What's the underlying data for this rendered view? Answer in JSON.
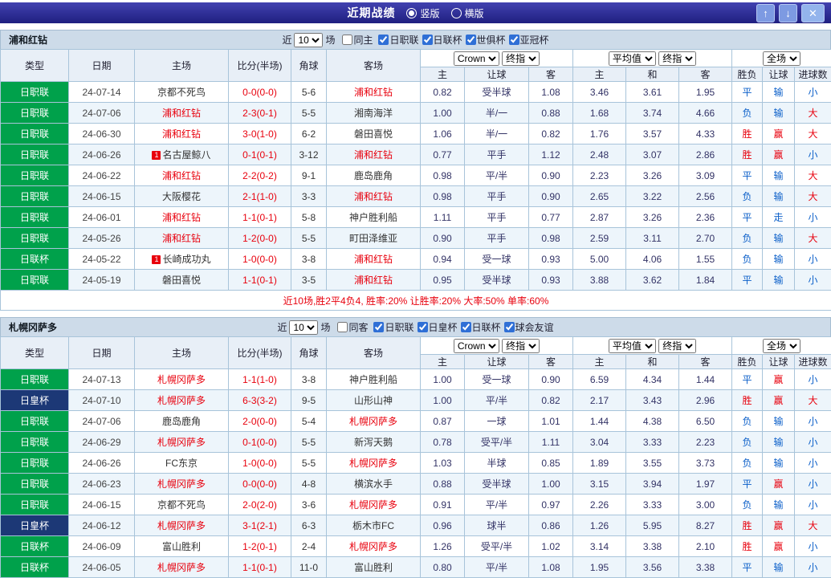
{
  "topbar": {
    "title": "近期战绩",
    "radios": [
      {
        "label": "竖版",
        "selected": true
      },
      {
        "label": "横版",
        "selected": false
      }
    ],
    "buttons": {
      "up": "↑",
      "down": "↓",
      "close": "✕"
    }
  },
  "filter_labels": {
    "near": "近",
    "games": "场"
  },
  "selects": {
    "company": "Crown",
    "final": "终指",
    "average": "平均值",
    "full": "全场"
  },
  "table_headers": {
    "left": [
      "类型",
      "日期",
      "主场",
      "比分(半场)",
      "角球",
      "客场"
    ],
    "odds_sub": [
      "主",
      "让球",
      "客"
    ],
    "avg_sub": [
      "主",
      "和",
      "客"
    ],
    "result_sub": [
      "胜负",
      "让球",
      "进球数"
    ]
  },
  "league_colors": {
    "日职联": "#00a14b",
    "日联杯": "#00a14b",
    "日皇杯": "#1c3876",
    "default": "#00a14b"
  },
  "red_results": [
    "胜",
    "赢",
    "大"
  ],
  "colors": {
    "result_red": "#e8000d",
    "result_blue": "#0b5fc9",
    "team_red": "#e8000d",
    "header_bar": "#2a2a96"
  },
  "sections": [
    {
      "team": "浦和红钻",
      "filter": {
        "count": "10",
        "toggle": {
          "label": "同主",
          "checked": false
        },
        "leagues": [
          {
            "label": "日职联",
            "checked": true
          },
          {
            "label": "日联杯",
            "checked": true
          },
          {
            "label": "世俱杯",
            "checked": true
          },
          {
            "label": "亚冠杯",
            "checked": true
          }
        ]
      },
      "rows": [
        {
          "league": "日职联",
          "date": "24-07-14",
          "home": "京都不死鸟",
          "home_team": false,
          "badge": "",
          "score": "0-0(0-0)",
          "corners": "5-6",
          "away": "浦和红钻",
          "away_team": true,
          "odds": [
            "0.82",
            "受半球",
            "1.08"
          ],
          "avg": [
            "3.46",
            "3.61",
            "1.95"
          ],
          "results": [
            "平",
            "输",
            "小"
          ]
        },
        {
          "league": "日职联",
          "date": "24-07-06",
          "home": "浦和红钻",
          "home_team": true,
          "badge": "",
          "score": "2-3(0-1)",
          "corners": "5-5",
          "away": "湘南海洋",
          "away_team": false,
          "odds": [
            "1.00",
            "半/一",
            "0.88"
          ],
          "avg": [
            "1.68",
            "3.74",
            "4.66"
          ],
          "results": [
            "负",
            "输",
            "大"
          ]
        },
        {
          "league": "日职联",
          "date": "24-06-30",
          "home": "浦和红钻",
          "home_team": true,
          "badge": "",
          "score": "3-0(1-0)",
          "corners": "6-2",
          "away": "磐田喜悦",
          "away_team": false,
          "odds": [
            "1.06",
            "半/一",
            "0.82"
          ],
          "avg": [
            "1.76",
            "3.57",
            "4.33"
          ],
          "results": [
            "胜",
            "赢",
            "大"
          ]
        },
        {
          "league": "日职联",
          "date": "24-06-26",
          "home": "名古屋鲸八",
          "home_team": false,
          "badge": "1",
          "score": "0-1(0-1)",
          "corners": "3-12",
          "away": "浦和红钻",
          "away_team": true,
          "odds": [
            "0.77",
            "平手",
            "1.12"
          ],
          "avg": [
            "2.48",
            "3.07",
            "2.86"
          ],
          "results": [
            "胜",
            "赢",
            "小"
          ]
        },
        {
          "league": "日职联",
          "date": "24-06-22",
          "home": "浦和红钻",
          "home_team": true,
          "badge": "",
          "score": "2-2(0-2)",
          "corners": "9-1",
          "away": "鹿岛鹿角",
          "away_team": false,
          "odds": [
            "0.98",
            "平/半",
            "0.90"
          ],
          "avg": [
            "2.23",
            "3.26",
            "3.09"
          ],
          "results": [
            "平",
            "输",
            "大"
          ]
        },
        {
          "league": "日职联",
          "date": "24-06-15",
          "home": "大阪樱花",
          "home_team": false,
          "badge": "",
          "score": "2-1(1-0)",
          "corners": "3-3",
          "away": "浦和红钻",
          "away_team": true,
          "odds": [
            "0.98",
            "平手",
            "0.90"
          ],
          "avg": [
            "2.65",
            "3.22",
            "2.56"
          ],
          "results": [
            "负",
            "输",
            "大"
          ]
        },
        {
          "league": "日职联",
          "date": "24-06-01",
          "home": "浦和红钻",
          "home_team": true,
          "badge": "",
          "score": "1-1(0-1)",
          "corners": "5-8",
          "away": "神户胜利船",
          "away_team": false,
          "odds": [
            "1.11",
            "平手",
            "0.77"
          ],
          "avg": [
            "2.87",
            "3.26",
            "2.36"
          ],
          "results": [
            "平",
            "走",
            "小"
          ]
        },
        {
          "league": "日职联",
          "date": "24-05-26",
          "home": "浦和红钻",
          "home_team": true,
          "badge": "",
          "score": "1-2(0-0)",
          "corners": "5-5",
          "away": "町田泽维亚",
          "away_team": false,
          "odds": [
            "0.90",
            "平手",
            "0.98"
          ],
          "avg": [
            "2.59",
            "3.11",
            "2.70"
          ],
          "results": [
            "负",
            "输",
            "大"
          ]
        },
        {
          "league": "日联杯",
          "date": "24-05-22",
          "home": "长崎成功丸",
          "home_team": false,
          "badge": "1",
          "score": "1-0(0-0)",
          "corners": "3-8",
          "away": "浦和红钻",
          "away_team": true,
          "odds": [
            "0.94",
            "受一球",
            "0.93"
          ],
          "avg": [
            "5.00",
            "4.06",
            "1.55"
          ],
          "results": [
            "负",
            "输",
            "小"
          ]
        },
        {
          "league": "日职联",
          "date": "24-05-19",
          "home": "磐田喜悦",
          "home_team": false,
          "badge": "",
          "score": "1-1(0-1)",
          "corners": "3-5",
          "away": "浦和红钻",
          "away_team": true,
          "odds": [
            "0.95",
            "受半球",
            "0.93"
          ],
          "avg": [
            "3.88",
            "3.62",
            "1.84"
          ],
          "results": [
            "平",
            "输",
            "小"
          ]
        }
      ],
      "summary": "近10场,胜2平4负4, 胜率:20% 让胜率:20% 大率:50% 单率:60%"
    },
    {
      "team": "札幌冈萨多",
      "filter": {
        "count": "10",
        "toggle": {
          "label": "同客",
          "checked": false
        },
        "leagues": [
          {
            "label": "日职联",
            "checked": true
          },
          {
            "label": "日皇杯",
            "checked": true
          },
          {
            "label": "日联杯",
            "checked": true
          },
          {
            "label": "球会友谊",
            "checked": true
          }
        ]
      },
      "rows": [
        {
          "league": "日职联",
          "date": "24-07-13",
          "home": "札幌冈萨多",
          "home_team": true,
          "badge": "",
          "score": "1-1(1-0)",
          "corners": "3-8",
          "away": "神户胜利船",
          "away_team": false,
          "odds": [
            "1.00",
            "受一球",
            "0.90"
          ],
          "avg": [
            "6.59",
            "4.34",
            "1.44"
          ],
          "results": [
            "平",
            "赢",
            "小"
          ]
        },
        {
          "league": "日皇杯",
          "date": "24-07-10",
          "home": "札幌冈萨多",
          "home_team": true,
          "badge": "",
          "score": "6-3(3-2)",
          "corners": "9-5",
          "away": "山形山神",
          "away_team": false,
          "odds": [
            "1.00",
            "平/半",
            "0.82"
          ],
          "avg": [
            "2.17",
            "3.43",
            "2.96"
          ],
          "results": [
            "胜",
            "赢",
            "大"
          ]
        },
        {
          "league": "日职联",
          "date": "24-07-06",
          "home": "鹿岛鹿角",
          "home_team": false,
          "badge": "",
          "score": "2-0(0-0)",
          "corners": "5-4",
          "away": "札幌冈萨多",
          "away_team": true,
          "odds": [
            "0.87",
            "一球",
            "1.01"
          ],
          "avg": [
            "1.44",
            "4.38",
            "6.50"
          ],
          "results": [
            "负",
            "输",
            "小"
          ]
        },
        {
          "league": "日职联",
          "date": "24-06-29",
          "home": "札幌冈萨多",
          "home_team": true,
          "badge": "",
          "score": "0-1(0-0)",
          "corners": "5-5",
          "away": "新泻天鹅",
          "away_team": false,
          "odds": [
            "0.78",
            "受平/半",
            "1.11"
          ],
          "avg": [
            "3.04",
            "3.33",
            "2.23"
          ],
          "results": [
            "负",
            "输",
            "小"
          ]
        },
        {
          "league": "日职联",
          "date": "24-06-26",
          "home": "FC东京",
          "home_team": false,
          "badge": "",
          "score": "1-0(0-0)",
          "corners": "5-5",
          "away": "札幌冈萨多",
          "away_team": true,
          "odds": [
            "1.03",
            "半球",
            "0.85"
          ],
          "avg": [
            "1.89",
            "3.55",
            "3.73"
          ],
          "results": [
            "负",
            "输",
            "小"
          ]
        },
        {
          "league": "日职联",
          "date": "24-06-23",
          "home": "札幌冈萨多",
          "home_team": true,
          "badge": "",
          "score": "0-0(0-0)",
          "corners": "4-8",
          "away": "横滨水手",
          "away_team": false,
          "odds": [
            "0.88",
            "受半球",
            "1.00"
          ],
          "avg": [
            "3.15",
            "3.94",
            "1.97"
          ],
          "results": [
            "平",
            "赢",
            "小"
          ]
        },
        {
          "league": "日职联",
          "date": "24-06-15",
          "home": "京都不死鸟",
          "home_team": false,
          "badge": "",
          "score": "2-0(2-0)",
          "corners": "3-6",
          "away": "札幌冈萨多",
          "away_team": true,
          "odds": [
            "0.91",
            "平/半",
            "0.97"
          ],
          "avg": [
            "2.26",
            "3.33",
            "3.00"
          ],
          "results": [
            "负",
            "输",
            "小"
          ]
        },
        {
          "league": "日皇杯",
          "date": "24-06-12",
          "home": "札幌冈萨多",
          "home_team": true,
          "badge": "",
          "score": "3-1(2-1)",
          "corners": "6-3",
          "away": "栃木市FC",
          "away_team": false,
          "odds": [
            "0.96",
            "球半",
            "0.86"
          ],
          "avg": [
            "1.26",
            "5.95",
            "8.27"
          ],
          "results": [
            "胜",
            "赢",
            "大"
          ]
        },
        {
          "league": "日联杯",
          "date": "24-06-09",
          "home": "富山胜利",
          "home_team": false,
          "badge": "",
          "score": "1-2(0-1)",
          "corners": "2-4",
          "away": "札幌冈萨多",
          "away_team": true,
          "odds": [
            "1.26",
            "受平/半",
            "1.02"
          ],
          "avg": [
            "3.14",
            "3.38",
            "2.10"
          ],
          "results": [
            "胜",
            "赢",
            "小"
          ]
        },
        {
          "league": "日联杯",
          "date": "24-06-05",
          "home": "札幌冈萨多",
          "home_team": true,
          "badge": "",
          "score": "1-1(0-1)",
          "corners": "11-0",
          "away": "富山胜利",
          "away_team": false,
          "odds": [
            "0.80",
            "平/半",
            "1.08"
          ],
          "avg": [
            "1.95",
            "3.56",
            "3.38"
          ],
          "results": [
            "平",
            "输",
            "小"
          ]
        }
      ],
      "summary": null
    }
  ]
}
